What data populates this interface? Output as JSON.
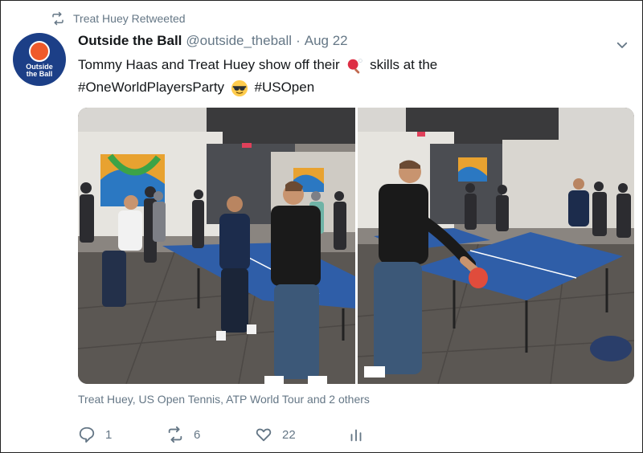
{
  "retweet_context": {
    "text": "Treat Huey Retweeted",
    "icon": "retweet-icon"
  },
  "author": {
    "name": "Outside the Ball",
    "handle": "@outside_theball",
    "separator": "·",
    "date": "Aug 22",
    "avatar_text": [
      "Outside",
      "the Ball"
    ]
  },
  "tweet": {
    "line1_before_emoji": "Tommy Haas and Treat Huey show off their",
    "line1_emoji": "ping-pong-emoji",
    "line1_after_emoji": "skills at the",
    "hashtag1": "#OneWorldPlayersParty",
    "line2_emoji": "sunglasses-face-emoji",
    "hashtag2": "#USOpen"
  },
  "media": {
    "photos": [
      {
        "label": "left-photo",
        "description": "ping pong game in event space"
      },
      {
        "label": "right-photo",
        "description": "player hitting ping pong ball"
      }
    ]
  },
  "tagged_line": "Treat Huey, US Open Tennis, ATP World Tour and 2 others",
  "actions": {
    "reply_count": "1",
    "retweet_count": "6",
    "like_count": "22"
  },
  "colors": {
    "text_primary": "#14171a",
    "text_secondary": "#657786",
    "avatar_bg": "#1c3f87",
    "avatar_ball": "#ef5a2a",
    "table_blue": "#2f5ea8"
  }
}
